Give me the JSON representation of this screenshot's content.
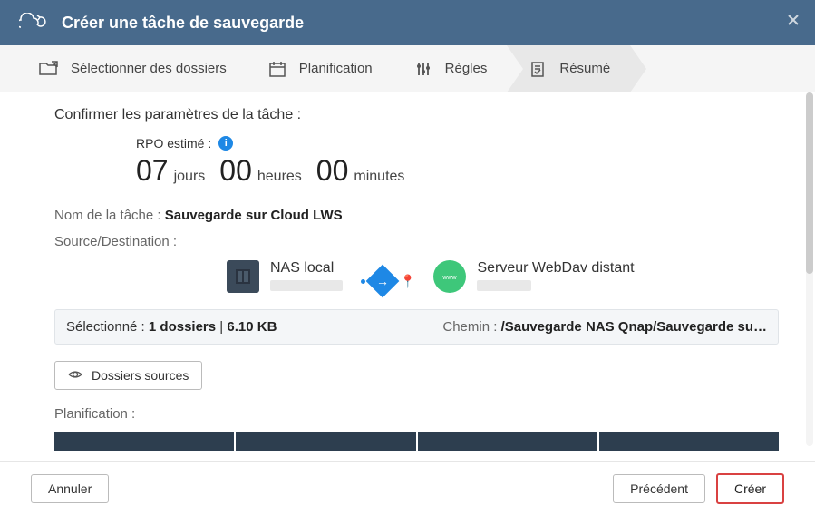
{
  "header": {
    "title": "Créer une tâche de sauvegarde"
  },
  "steps": {
    "s1": "Sélectionner des dossiers",
    "s2": "Planification",
    "s3": "Règles",
    "s4": "Résumé"
  },
  "content": {
    "confirm": "Confirmer les paramètres de la tâche :",
    "rpo_label": "RPO estimé :",
    "rpo_days_num": "07",
    "rpo_days_unit": "jours",
    "rpo_hours_num": "00",
    "rpo_hours_unit": "heures",
    "rpo_minutes_num": "00",
    "rpo_minutes_unit": "minutes",
    "task_name_label": "Nom de la tâche :",
    "task_name_value": "Sauvegarde sur Cloud LWS",
    "sd_label": "Source/Destination :",
    "source_name": "NAS local",
    "dest_name": "Serveur WebDav distant",
    "selected_label": "Sélectionné : ",
    "selected_folders": "1 dossiers",
    "selected_sep": " | ",
    "selected_size": "6.10 KB",
    "path_label": "Chemin : ",
    "path_value": "/Sauvegarde NAS Qnap/Sauvegarde su…",
    "source_folders_btn": "Dossiers sources",
    "planning_label": "Planification :"
  },
  "footer": {
    "cancel": "Annuler",
    "previous": "Précédent",
    "create": "Créer"
  }
}
